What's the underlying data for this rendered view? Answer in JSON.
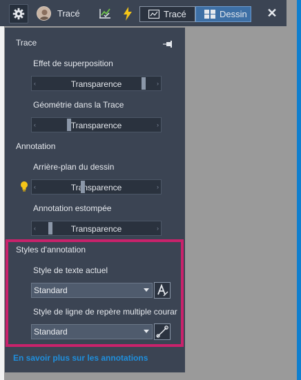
{
  "toolbar": {
    "title": "Tracé",
    "icons": [
      "gear-icon",
      "avatar",
      "check-chart-icon",
      "lightning-icon",
      "close-icon"
    ],
    "modes": [
      {
        "label": "Tracé",
        "icon": "trace-mode-icon",
        "active": false
      },
      {
        "label": "Dessin",
        "icon": "grid-mode-icon",
        "active": true
      }
    ],
    "close_label": "✕"
  },
  "panel": {
    "trace": {
      "heading": "Trace",
      "overlay_label": "Effet de superposition",
      "overlay_value": "Transparence",
      "overlay_level": 0.88,
      "geometry_label": "Géométrie dans la Trace",
      "geometry_value": "Transparence",
      "geometry_level": 0.28
    },
    "annotation": {
      "heading": "Annotation",
      "background_label": "Arrière-plan du dessin",
      "background_value": "Transparence",
      "background_level": 0.39,
      "faded_label": "Annotation estompée",
      "faded_value": "Transparence",
      "faded_level": 0.13
    },
    "styles": {
      "heading": "Styles d'annotation",
      "text_style_label": "Style de texte actuel",
      "text_style_value": "Standard",
      "leader_style_label": "Style de ligne de repère multiple courar",
      "leader_style_value": "Standard"
    },
    "learn_more": "En savoir plus sur les annotations"
  },
  "colors": {
    "panel_bg": "#3b4453",
    "accent_blue": "#1f8fdd",
    "highlight": "#c9226b",
    "active_mode": "#3d6fa5"
  }
}
